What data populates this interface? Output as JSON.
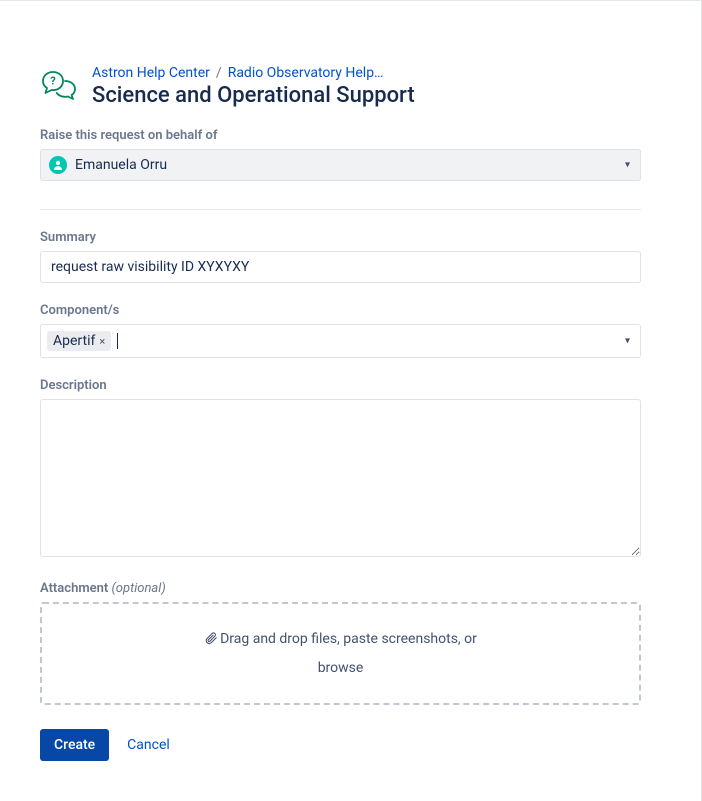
{
  "breadcrumbs": {
    "root": "Astron Help Center",
    "portal": "Radio Observatory Help…"
  },
  "page_title": "Science and Operational Support",
  "requester": {
    "label": "Raise this request on behalf of",
    "name": "Emanuela Orru"
  },
  "summary": {
    "label": "Summary",
    "value": "request raw visibility ID XYXYXY"
  },
  "components": {
    "label": "Component/s",
    "tag": "Apertif",
    "tag_remove_symbol": "×"
  },
  "description": {
    "label": "Description",
    "value": ""
  },
  "attachment": {
    "label": "Attachment",
    "optional": "(optional)",
    "drop_text": "Drag and drop files, paste screenshots, or",
    "browse": "browse"
  },
  "actions": {
    "create": "Create",
    "cancel": "Cancel"
  }
}
